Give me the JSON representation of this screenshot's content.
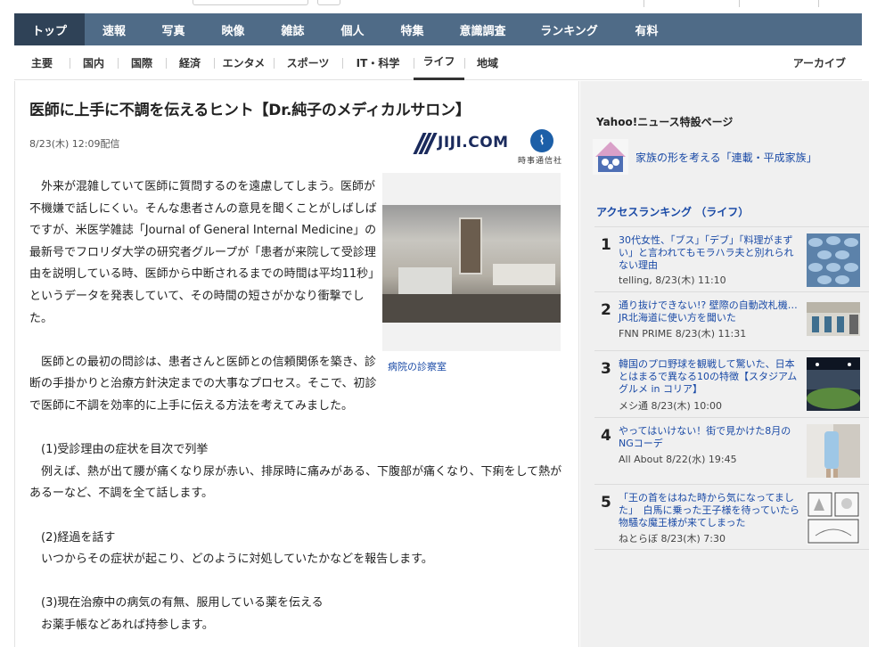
{
  "main_nav": {
    "items": [
      "トップ",
      "速報",
      "写真",
      "映像",
      "雑誌",
      "個人",
      "特集",
      "意識調査",
      "ランキング",
      "有料"
    ],
    "active_index": 0
  },
  "sub_nav": {
    "items": [
      "主要",
      "国内",
      "国際",
      "経済",
      "エンタメ",
      "スポーツ",
      "IT・科学",
      "ライフ",
      "地域"
    ],
    "active_index": 7,
    "archive_label": "アーカイブ"
  },
  "article": {
    "title": "医師に上手に不調を伝えるヒント【Dr.純子のメディカルサロン】",
    "date": "8/23(木) 12:09配信",
    "source_logo": {
      "name": "JIJI.COM",
      "sub": "時事通信社"
    },
    "photo_caption": "病院の診察室",
    "paragraphs": [
      "　外来が混雑していて医師に質問するのを遠慮してしまう。医師が不機嫌で話しにくい。そんな患者さんの意見を聞くことがしばしばですが、米医学雑誌「Journal of General Internal Medicine」の最新号でフロリダ大学の研究者グループが「患者が来院して受診理由を説明している時、医師から中断されるまでの時間は平均11秒」というデータを発表していて、その時間の短さがかなり衝撃でした。",
      "　医師との最初の問診は、患者さんと医師との信頼関係を築き、診断の手掛かりと治療方針決定までの大事なプロセス。そこで、初診で医師に不調を効率的に上手に伝える方法を考えてみました。",
      "　(1)受診理由の症状を目次で列挙",
      "　例えば、熱が出て腰が痛くなり尿が赤い、排尿時に痛みがある、下腹部が痛くなり、下痢をして熱があるーなど、不調を全て話します。",
      "　(2)経過を話す",
      "　いつからその症状が起こり、どのように対処していたかなどを報告します。",
      "　(3)現在治療中の病気の有無、服用している薬を伝える",
      "　お薬手帳などあれば持参します。"
    ]
  },
  "sidebar": {
    "feature_heading": "Yahoo!ニュース特設ページ",
    "feature_link": "家族の形を考える「連載・平成家族」",
    "ranking_heading": "アクセスランキング （ライフ）",
    "ranking": [
      {
        "rank": "1",
        "title": "30代女性、「ブス」「デブ」「料理がまずい」と言われてもモラハラ夫と別れられない理由",
        "source": "telling,  8/23(木) 11:10",
        "thumb": "pattern-blue"
      },
      {
        "rank": "2",
        "title": "通り抜けできない!? 壁際の自動改札機…JR北海道に使い方を聞いた",
        "source": "FNN PRIME 8/23(木) 11:31",
        "thumb": "station-gates"
      },
      {
        "rank": "3",
        "title": "韓国のプロ野球を観戦して驚いた、日本とはまるで異なる10の特徴【スタジアムグルメ in コリア】",
        "source": "メシ通 8/23(木) 10:00",
        "thumb": "stadium"
      },
      {
        "rank": "4",
        "title": "やってはいけない！街で見かけた8月のNGコーデ",
        "source": "All About 8/22(水) 19:45",
        "thumb": "street-fashion"
      },
      {
        "rank": "5",
        "title": "「王の首をはねた時から気になってました」　白馬に乗った王子様を待っていたら物騒な魔王様が来てしまった",
        "source": "ねとらぼ 8/23(木) 7:30",
        "thumb": "manga"
      }
    ]
  },
  "colors": {
    "nav_bg": "#4f6b87",
    "nav_active": "#2f4257",
    "link": "#1a4aa6",
    "sidebar_bg": "#f0f0f0"
  }
}
